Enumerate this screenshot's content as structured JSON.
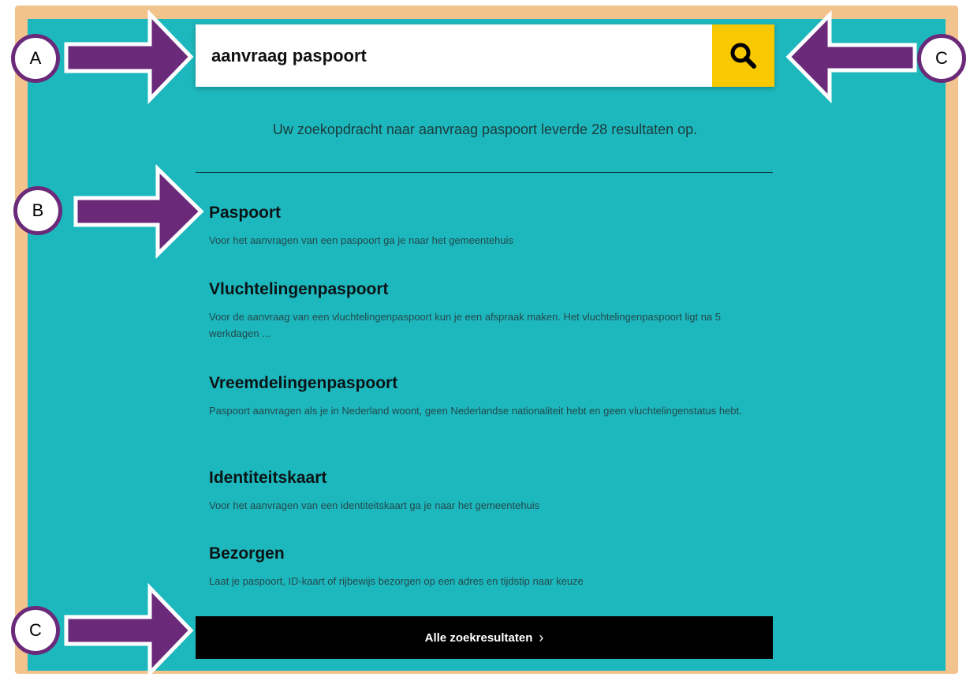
{
  "search": {
    "value": "aanvraag paspoort",
    "button_icon": "search-icon",
    "button_color": "#f8c900"
  },
  "summary": "Uw zoekopdracht naar aanvraag paspoort leverde 28 resultaten op.",
  "results": [
    {
      "title": "Paspoort",
      "description": "Voor het aanvragen van een paspoort ga je naar het gemeentehuis"
    },
    {
      "title": "Vluchtelingenpaspoort",
      "description": "Voor de aanvraag van een vluchtelingenpaspoort kun je een afspraak maken. Het vluchtelingenpaspoort ligt na 5 werkdagen ..."
    },
    {
      "title": "Vreemdelingenpaspoort",
      "description": "Paspoort aanvragen als je in Nederland woont, geen Nederlandse nationaliteit hebt en geen vluchtelingenstatus hebt."
    },
    {
      "title": "Identiteitskaart",
      "description": "Voor het aanvragen van een identiteitskaart ga je naar het gemeentehuis"
    },
    {
      "title": "Bezorgen",
      "description": "Laat je paspoort, ID-kaart of rijbewijs bezorgen op een adres en tijdstip naar keuze"
    }
  ],
  "all_results_button": {
    "label": "Alle zoekresultaten",
    "chevron": "›"
  },
  "callouts": {
    "a": "A",
    "b": "B",
    "c_top": "C",
    "c_bottom": "C"
  },
  "colors": {
    "panel": "#1db8bd",
    "frame": "#f3c38e",
    "arrow": "#6a2a79"
  }
}
